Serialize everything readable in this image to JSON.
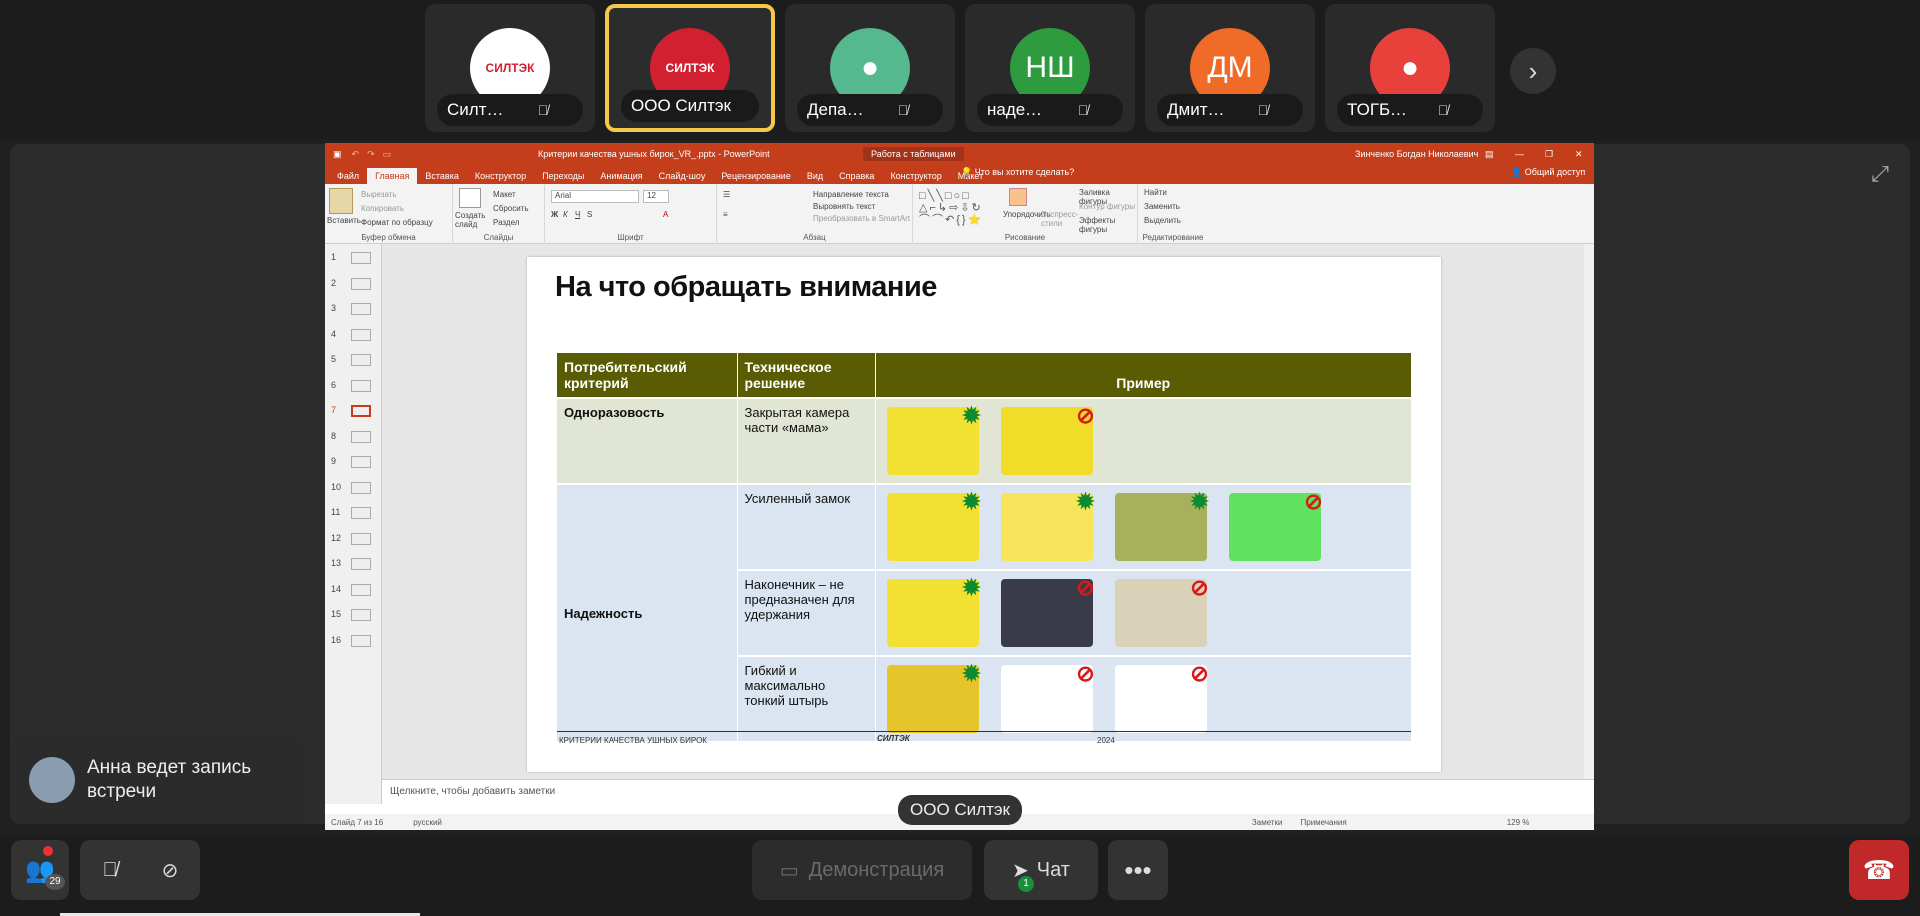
{
  "participants": [
    {
      "name": "Силтэк Ко...",
      "avatar_text": "СИЛТЭК",
      "avatar_color": "#ffffff",
      "muted": true,
      "active": false
    },
    {
      "name": "ООО Силтэк",
      "avatar_text": "СИЛТЭК",
      "avatar_color": "#d32030",
      "muted": false,
      "active": true
    },
    {
      "name": "Департам...",
      "avatar_text": "",
      "avatar_color": "#56b88f",
      "muted": true,
      "active": false
    },
    {
      "name": "надежда ш.",
      "avatar_text": "НШ",
      "avatar_color": "#2f9b3f",
      "muted": true,
      "active": false
    },
    {
      "name": "Дмитрий М.",
      "avatar_text": "ДМ",
      "avatar_color": "#f06a28",
      "muted": true,
      "active": false
    },
    {
      "name": "ТОГБУ Бо...",
      "avatar_text": "",
      "avatar_color": "#e8413c",
      "muted": true,
      "active": false
    }
  ],
  "ppt": {
    "title": "Критерии качества ушных бирок_VR_.pptx - PowerPoint",
    "context_tab": "Работа с таблицами",
    "user": "Зинченко Богдан Николаевич",
    "tabs": [
      "Файл",
      "Главная",
      "Вставка",
      "Конструктор",
      "Переходы",
      "Анимация",
      "Слайд-шоу",
      "Рецензирование",
      "Вид",
      "Справка",
      "Конструктор",
      "Макет"
    ],
    "tell_me": "Что вы хотите сделать?",
    "share": "Общий доступ",
    "groups": [
      "Буфер обмена",
      "Слайды",
      "Шрифт",
      "Абзац",
      "Рисование",
      "Редактирование"
    ],
    "font_name": "Arial",
    "font_size": "12",
    "clipboard": {
      "paste": "Вставить",
      "cut": "Вырезать",
      "copy": "Копировать",
      "format": "Формат по образцу"
    },
    "slides_grp": {
      "new": "Создать слайд",
      "layout": "Макет",
      "reset": "Сбросить",
      "section": "Раздел"
    },
    "para": {
      "dir": "Направление текста",
      "align": "Выровнять текст",
      "smart": "Преобразовать в SmartArt"
    },
    "draw": {
      "arrange": "Упорядочить",
      "express": "Экспресс-стили",
      "fill": "Заливка фигуры",
      "outline": "Контур фигуры",
      "effects": "Эффекты фигуры"
    },
    "edit": {
      "find": "Найти",
      "replace": "Заменить",
      "select": "Выделить"
    },
    "slide_numbers": [
      "1",
      "2",
      "3",
      "4",
      "5",
      "6",
      "7",
      "8",
      "9",
      "10",
      "11",
      "12",
      "13",
      "14",
      "15",
      "16"
    ],
    "selected_slide": "7",
    "notes_placeholder": "Щелкните, чтобы добавить заметки",
    "status_slide": "Слайд 7 из 16",
    "status_lang": "русский",
    "status_notes": "Заметки",
    "status_comments": "Примечания",
    "zoom": "129 %"
  },
  "slide": {
    "title": "На что обращать внимание",
    "headers": [
      "Потребительский критерий",
      "Техническое решение",
      "Пример"
    ],
    "rows": [
      {
        "criterion": "Одноразовость",
        "solution": "Закрытая камера части «мама»",
        "marks": [
          "ok",
          "no"
        ]
      },
      {
        "criterion": "Надежность",
        "solution": "Усиленный замок",
        "marks": [
          "ok",
          "ok",
          "ok",
          "no"
        ]
      },
      {
        "criterion": "",
        "solution": "Наконечник – не предназначен для удержания",
        "marks": [
          "ok",
          "no",
          "no"
        ]
      },
      {
        "criterion": "",
        "solution": "Гибкий и максимально тонкий штырь",
        "marks": [
          "ok",
          "no",
          "no"
        ]
      }
    ],
    "footer_left": "КРИТЕРИИ КАЧЕСТВА УШНЫХ БИРОК",
    "footer_center": "СИЛТЭК",
    "footer_right": "2024"
  },
  "presenter_label": "ООО Силтэк",
  "recording_notice": "Анна ведет запись встречи",
  "controls": {
    "participants_count": "29",
    "demo_label": "Демонстрация",
    "chat_label": "Чат",
    "chat_badge": "1"
  }
}
